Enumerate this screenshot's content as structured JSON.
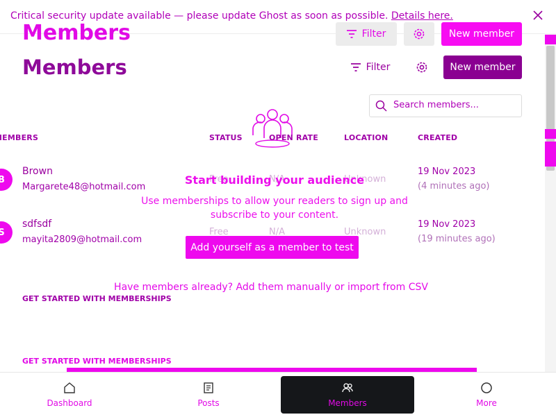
{
  "banner": {
    "text": "Critical security update available — please update Ghost as soon as possible.",
    "link": "Details here."
  },
  "header_overlay": {
    "title": "Members",
    "filter_label": "Filter",
    "new_member_label": "New member"
  },
  "header": {
    "title": "Members",
    "filter_label": "Filter",
    "new_member_label": "New member"
  },
  "search": {
    "placeholder": "Search members..."
  },
  "table": {
    "columns": [
      "MEMBERS",
      "STATUS",
      "OPEN RATE",
      "LOCATION",
      "CREATED"
    ],
    "rows": [
      {
        "initial": "B",
        "name": "Brown",
        "email": "Margarete48@hotmail.com",
        "status": "Free",
        "open_rate": "N/A",
        "location": "Unknown",
        "created": "19 Nov 2023",
        "created_ago": "(4 minutes ago)"
      },
      {
        "initial": "S",
        "name": "sdfsdf",
        "email": "mayita2809@hotmail.com",
        "status": "Free",
        "open_rate": "N/A",
        "location": "Unknown",
        "created": "19 Nov 2023",
        "created_ago": "(19 minutes ago)"
      }
    ]
  },
  "empty_state": {
    "title": "Start building your audience",
    "description": "Use memberships to allow your readers to sign up and subscribe to your content.",
    "add_button": "Add yourself as a member to test",
    "import_prefix": "Have members already? Add them manually or ",
    "import_link": "import from CSV"
  },
  "get_started": {
    "label1": "GET STARTED WITH MEMBERSHIPS",
    "label2": "GET STARTED WITH MEMBERSHIPS"
  },
  "bottom_nav": {
    "items": [
      {
        "label": "Dashboard",
        "icon": "home-icon"
      },
      {
        "label": "Posts",
        "icon": "posts-icon"
      },
      {
        "label": "Members",
        "icon": "members-icon",
        "active": true
      },
      {
        "label": "More",
        "icon": "more-icon"
      }
    ]
  },
  "colors": {
    "accent": "#e10ae6",
    "primary_dark": "#8a0091",
    "nav_active": "#15171a"
  }
}
